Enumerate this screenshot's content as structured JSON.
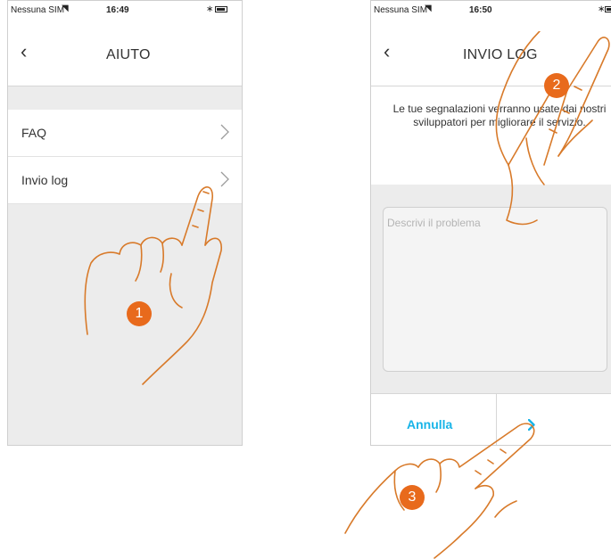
{
  "screen1": {
    "status": {
      "carrier": "Nessuna SIM",
      "time": "16:49"
    },
    "nav": {
      "back": "‹",
      "title": "AIUTO"
    },
    "menu": [
      {
        "label": "FAQ"
      },
      {
        "label": "Invio log"
      }
    ],
    "step": "1"
  },
  "screen2": {
    "status": {
      "carrier": "Nessuna SIM",
      "time": "16:50"
    },
    "nav": {
      "back": "‹",
      "title": "INVIO LOG"
    },
    "description": "Le tue segnalazioni verranno usate dai nostri sviluppatori per migliorare il servizio.",
    "textarea_placeholder": "Descrivi il problema",
    "cancel_label": "Annulla",
    "next_icon": "chevron-right-icon",
    "step_describe": "2",
    "step_send": "3"
  },
  "colors": {
    "accent": "#18b4e8",
    "badge": "#e86a1c",
    "hand_outline": "#d87a2a"
  }
}
